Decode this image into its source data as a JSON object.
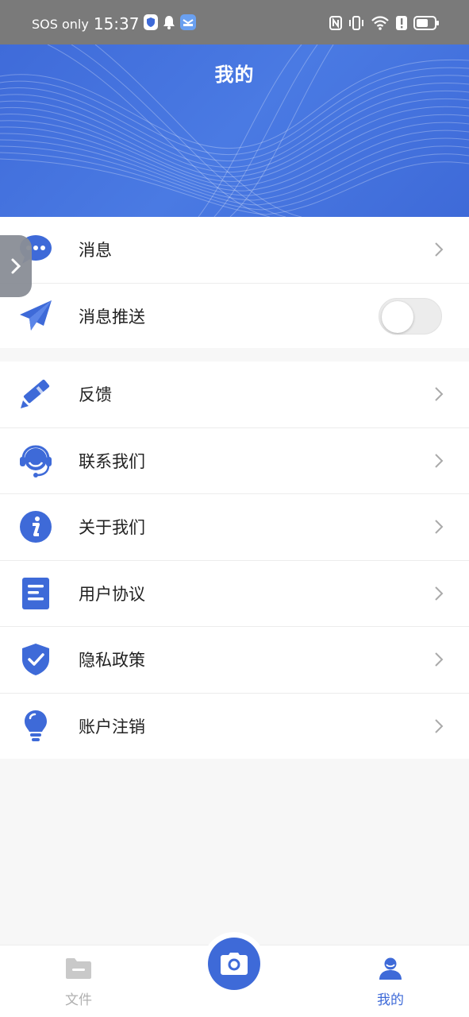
{
  "status_bar": {
    "carrier": "SOS only",
    "time": "15:37"
  },
  "header": {
    "title": "我的"
  },
  "group1": [
    {
      "label": "消息",
      "icon": "chat-bubble-icon",
      "control": "chevron"
    },
    {
      "label": "消息推送",
      "icon": "paper-plane-icon",
      "control": "toggle",
      "toggle_on": false
    }
  ],
  "group2": [
    {
      "label": "反馈",
      "icon": "pencil-icon"
    },
    {
      "label": "联系我们",
      "icon": "headset-icon"
    },
    {
      "label": "关于我们",
      "icon": "info-icon"
    },
    {
      "label": "用户协议",
      "icon": "document-icon"
    },
    {
      "label": "隐私政策",
      "icon": "shield-check-icon"
    },
    {
      "label": "账户注销",
      "icon": "lightbulb-icon"
    }
  ],
  "bottom_nav": {
    "files_label": "文件",
    "mine_label": "我的",
    "active": "mine"
  },
  "colors": {
    "accent": "#3e6ad8",
    "status_bar_bg": "#7a7a7a",
    "inactive": "#b0b0b0"
  }
}
